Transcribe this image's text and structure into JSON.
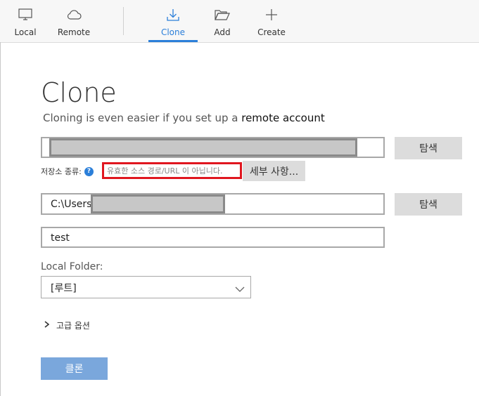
{
  "toolbar": {
    "local_label": "Local",
    "remote_label": "Remote",
    "clone_label": "Clone",
    "add_label": "Add",
    "create_label": "Create",
    "active_tab": "Clone"
  },
  "page": {
    "title": "Clone",
    "subtitle_prefix": "Cloning is even easier if you set up a",
    "subtitle_link": "remote account"
  },
  "source": {
    "browse_label": "탐색",
    "repo_type_label": "저장소 종류:",
    "help_glyph": "?",
    "error_text": "유효한 소스 경로/URL 이 아닙니다.",
    "details_label": "세부 사항..."
  },
  "destination": {
    "path_prefix": "C:\\Users",
    "browse_label": "탐색"
  },
  "name_field": {
    "value": "test"
  },
  "local_folder": {
    "label": "Local Folder:",
    "value": "[루트]"
  },
  "advanced": {
    "label": "고급 옵션"
  },
  "clone_button": {
    "label": "클론"
  },
  "colors": {
    "accent": "#2b7fd9",
    "error": "#e0161f",
    "primary_button": "#7aa7dc"
  },
  "icons": {
    "local": "monitor-icon",
    "remote": "cloud-icon",
    "clone": "download-icon",
    "add": "folder-open-icon",
    "create": "plus-icon",
    "help": "question-circle-icon",
    "dropdown": "chevron-down-icon",
    "advanced": "chevron-right-icon"
  }
}
